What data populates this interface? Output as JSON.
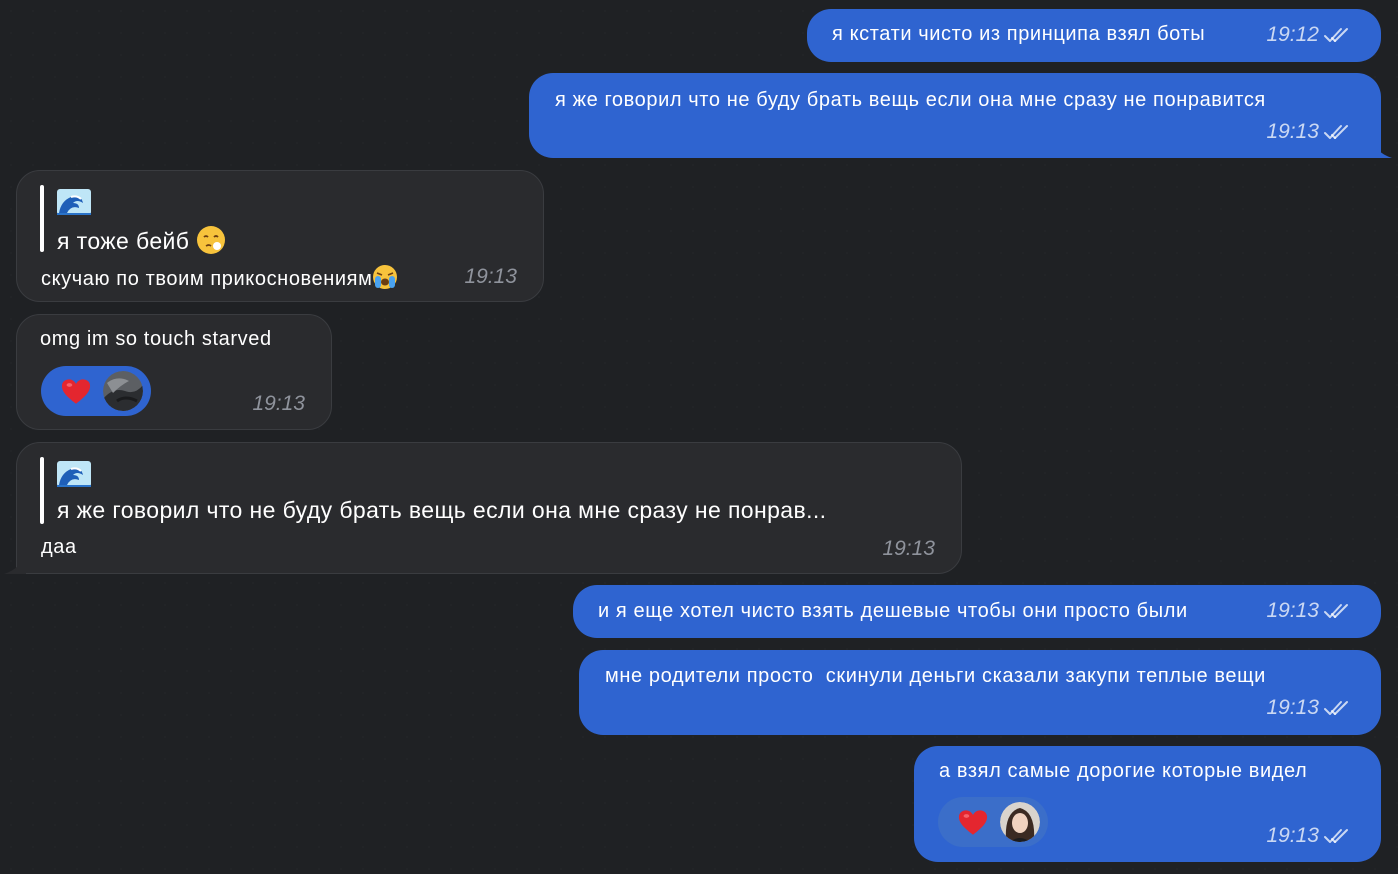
{
  "colors": {
    "outgoing": "#2f64d0",
    "incoming": "#2a2b2e",
    "background": "#1f2124"
  },
  "messages": [
    {
      "dir": "out",
      "text": "я кстати чисто из принципа взял боты",
      "time": "19:12"
    },
    {
      "dir": "out",
      "text": "я же говорил что не буду брать вещь если она мне сразу не понравится",
      "time": "19:13"
    },
    {
      "dir": "in",
      "reply_icon": "wave-emoji",
      "reply_text": "я тоже бейб",
      "text": "скучаю по твоим прикосновениям",
      "time": "19:13"
    },
    {
      "dir": "in",
      "text": "omg im so touch starved",
      "time": "19:13",
      "reaction": "heart"
    },
    {
      "dir": "in",
      "reply_icon": "wave-emoji",
      "reply_text": "я же говорил что не буду брать вещь если она мне сразу не понрав...",
      "text": "даа",
      "time": "19:13"
    },
    {
      "dir": "out",
      "text": "и я еще хотел чисто взять дешевые чтобы они просто были",
      "time": "19:13"
    },
    {
      "dir": "out",
      "text": "мне родители просто  скинули деньги сказали закупи теплые вещи",
      "time": "19:13"
    },
    {
      "dir": "out",
      "text": "а взял самые дорогие которые видел",
      "time": "19:13",
      "reaction": "heart"
    }
  ]
}
